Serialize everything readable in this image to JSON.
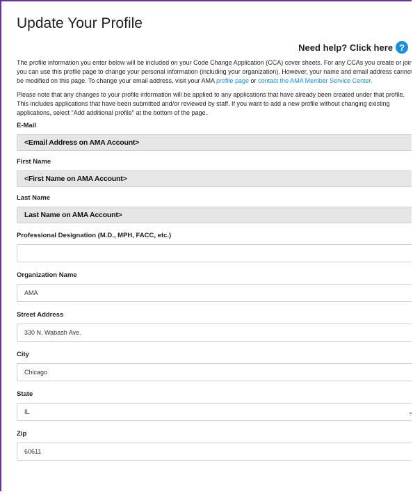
{
  "page": {
    "title": "Update Your Profile",
    "help_label": "Need help? Click here",
    "help_icon": "question-circle-icon"
  },
  "intro": {
    "p1_text": "The profile information you enter below will be included on your Code Change Application (CCA) cover sheets. For any CCAs you create or join, you can use this profile page to change your personal information (including your organization). However, your name and email address cannot be modified on this page. To change your email address, visit your AMA ",
    "p1_link1": "profile page",
    "p1_or": " or ",
    "p1_link2": "contact the AMA Member Service Center.",
    "p2_text": "Please note that any changes to your profile information will be applied to any applications that have already been created under that profile. This includes applications that have been submitted and/or reviewed by staff. If you want to add a new profile without changing existing applications, select \"Add additional profile\" at the bottom of the page."
  },
  "fields": {
    "email": {
      "label": "E-Mail",
      "value": "<Email Address on AMA Account>"
    },
    "first_name": {
      "label": "First Name",
      "value": "<First Name on AMA Account>"
    },
    "last_name": {
      "label": "Last Name",
      "value": "Last Name on AMA Account>"
    },
    "designation": {
      "label": "Professional Designation (M.D., MPH, FACC, etc.)",
      "value": ""
    },
    "organization": {
      "label": "Organization Name",
      "value": "AMA"
    },
    "street": {
      "label": "Street Address",
      "value": "330 N. Wabash Ave."
    },
    "city": {
      "label": "City",
      "value": "Chicago"
    },
    "state": {
      "label": "State",
      "value": "IL"
    },
    "zip": {
      "label": "Zip",
      "value": "60611"
    }
  },
  "colors": {
    "accent": "#1a8fd8",
    "frame": "#6b2fa0",
    "readonly_bg": "#e6e6e6"
  }
}
